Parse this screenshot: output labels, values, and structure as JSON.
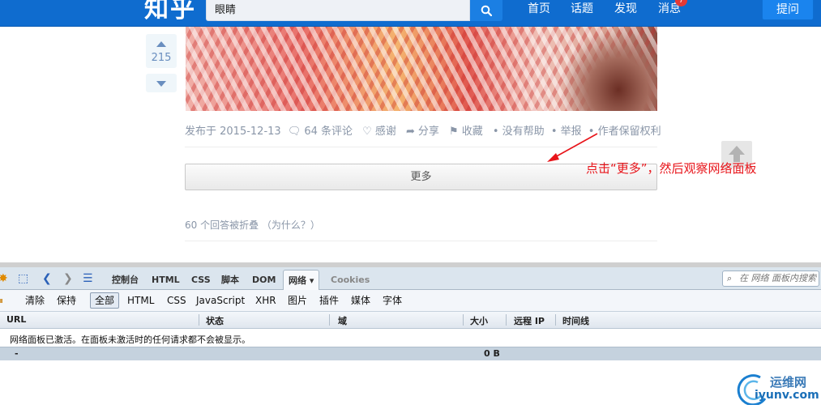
{
  "topbar": {
    "logo": "知乎",
    "search_value": "眼睛",
    "nav": [
      "首页",
      "话题",
      "发现",
      "消息"
    ],
    "badge": "7",
    "ask_label": "提问"
  },
  "answer": {
    "vote_count": "215",
    "meta": {
      "posted": "发布于 2015-12-13",
      "comments": "64 条评论",
      "thanks": "感谢",
      "share": "分享",
      "collect": "收藏",
      "unhelpful": "• 没有帮助",
      "report": "• 举报",
      "rights": "• 作者保留权利"
    },
    "more_label": "更多",
    "folded_text": "60 个回答被折叠 （为什么？）"
  },
  "annotation": "点击“更多”，然后观察网络面板",
  "firebug": {
    "tabs": [
      "控制台",
      "HTML",
      "CSS",
      "脚本",
      "DOM",
      "网络 ▾",
      "Cookies"
    ],
    "search_placeholder": "在 网络 面板内搜索",
    "filters": [
      "清除",
      "保持",
      "全部",
      "HTML",
      "CSS",
      "JavaScript",
      "XHR",
      "图片",
      "插件",
      "媒体",
      "字体"
    ],
    "columns": [
      "URL",
      "状态",
      "域",
      "大小",
      "远程 IP",
      "时间线"
    ],
    "message": "网络面板已激活。在面板未激活时的任何请求都不会被显示。",
    "summary_dash": "-",
    "summary_size": "0 B"
  },
  "watermark": {
    "cn": "运维网",
    "en": "iyunv.com"
  },
  "colors": {
    "brand_blue": "#0f6ccf",
    "annotation_red": "#e8141a"
  }
}
